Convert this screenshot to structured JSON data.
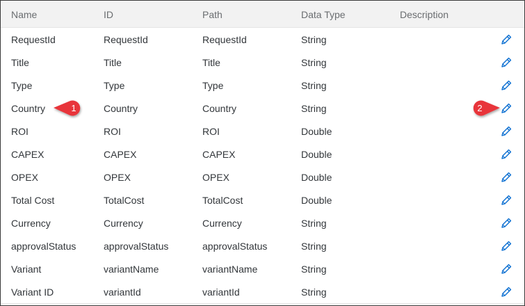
{
  "columns": {
    "name": "Name",
    "id": "ID",
    "path": "Path",
    "data_type": "Data Type",
    "description": "Description"
  },
  "rows": [
    {
      "name": "RequestId",
      "id": "RequestId",
      "path": "RequestId",
      "data_type": "String",
      "description": ""
    },
    {
      "name": "Title",
      "id": "Title",
      "path": "Title",
      "data_type": "String",
      "description": ""
    },
    {
      "name": "Type",
      "id": "Type",
      "path": "Type",
      "data_type": "String",
      "description": ""
    },
    {
      "name": "Country",
      "id": "Country",
      "path": "Country",
      "data_type": "String",
      "description": ""
    },
    {
      "name": "ROI",
      "id": "ROI",
      "path": "ROI",
      "data_type": "Double",
      "description": ""
    },
    {
      "name": "CAPEX",
      "id": "CAPEX",
      "path": "CAPEX",
      "data_type": "Double",
      "description": ""
    },
    {
      "name": "OPEX",
      "id": "OPEX",
      "path": "OPEX",
      "data_type": "Double",
      "description": ""
    },
    {
      "name": "Total Cost",
      "id": "TotalCost",
      "path": "TotalCost",
      "data_type": "Double",
      "description": ""
    },
    {
      "name": "Currency",
      "id": "Currency",
      "path": "Currency",
      "data_type": "String",
      "description": ""
    },
    {
      "name": "approvalStatus",
      "id": "approvalStatus",
      "path": "approvalStatus",
      "data_type": "String",
      "description": ""
    },
    {
      "name": "Variant",
      "id": "variantName",
      "path": "variantName",
      "data_type": "String",
      "description": ""
    },
    {
      "name": "Variant ID",
      "id": "variantId",
      "path": "variantId",
      "data_type": "String",
      "description": ""
    }
  ],
  "row_action_icon": "pencil-edit-icon",
  "callouts": [
    {
      "number": "1"
    },
    {
      "number": "2"
    }
  ],
  "colors": {
    "header_bg": "#f2f2f2",
    "row_border": "#e5e5e5",
    "text": "#32363a",
    "header_text": "#6a6d70",
    "edit_icon": "#0a6ed1",
    "callout": "#e8363b"
  }
}
